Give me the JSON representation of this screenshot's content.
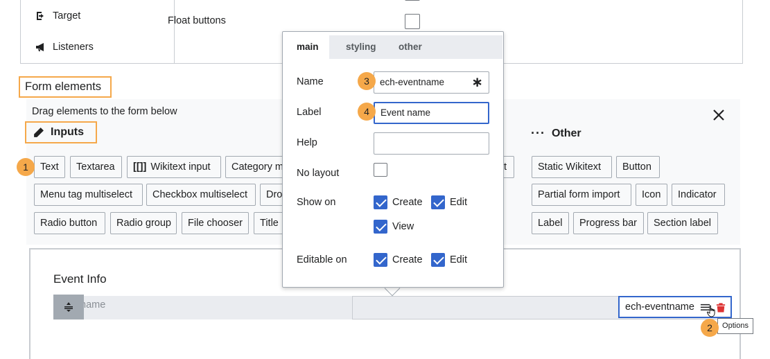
{
  "top": {
    "nav_target": "Target",
    "nav_listeners": "Listeners",
    "float_buttons_label": "Float buttons"
  },
  "form_elements": {
    "title": "Form elements",
    "hint": "Drag elements to the form below",
    "inputs_title": "Inputs",
    "other_title": "Other",
    "inputs": [
      "Text",
      "Textarea",
      "Wikitext input",
      "Category m",
      "Menu tag multiselect",
      "Checkbox multiselect",
      "Dro",
      "Radio button",
      "Radio group",
      "File chooser",
      "Title",
      "t"
    ],
    "other": [
      "Static Wikitext",
      "Button",
      "Partial form import",
      "Icon",
      "Indicator",
      "Label",
      "Progress bar",
      "Section label"
    ]
  },
  "popup": {
    "tabs": [
      "main",
      "styling",
      "other"
    ],
    "active_tab": "main",
    "name_label": "Name",
    "name_value": "ech-eventname",
    "name_required_mark": "∗",
    "label_label": "Label",
    "label_value": "Event name",
    "help_label": "Help",
    "help_value": "",
    "nolayout_label": "No layout",
    "nolayout_checked": false,
    "showon_label": "Show on",
    "showon_create": "Create",
    "showon_edit": "Edit",
    "showon_view": "View",
    "editableon_label": "Editable on",
    "editableon_create": "Create",
    "editableon_edit": "Edit"
  },
  "form_preview": {
    "section_title": "Event Info",
    "row_placeholder": "name",
    "field_name": "ech-eventname",
    "tooltip": "Options"
  },
  "badges": [
    "1",
    "2",
    "3",
    "4"
  ],
  "colors": {
    "accent": "#3366cc",
    "highlight": "#f5a84a",
    "delete": "#d33"
  }
}
